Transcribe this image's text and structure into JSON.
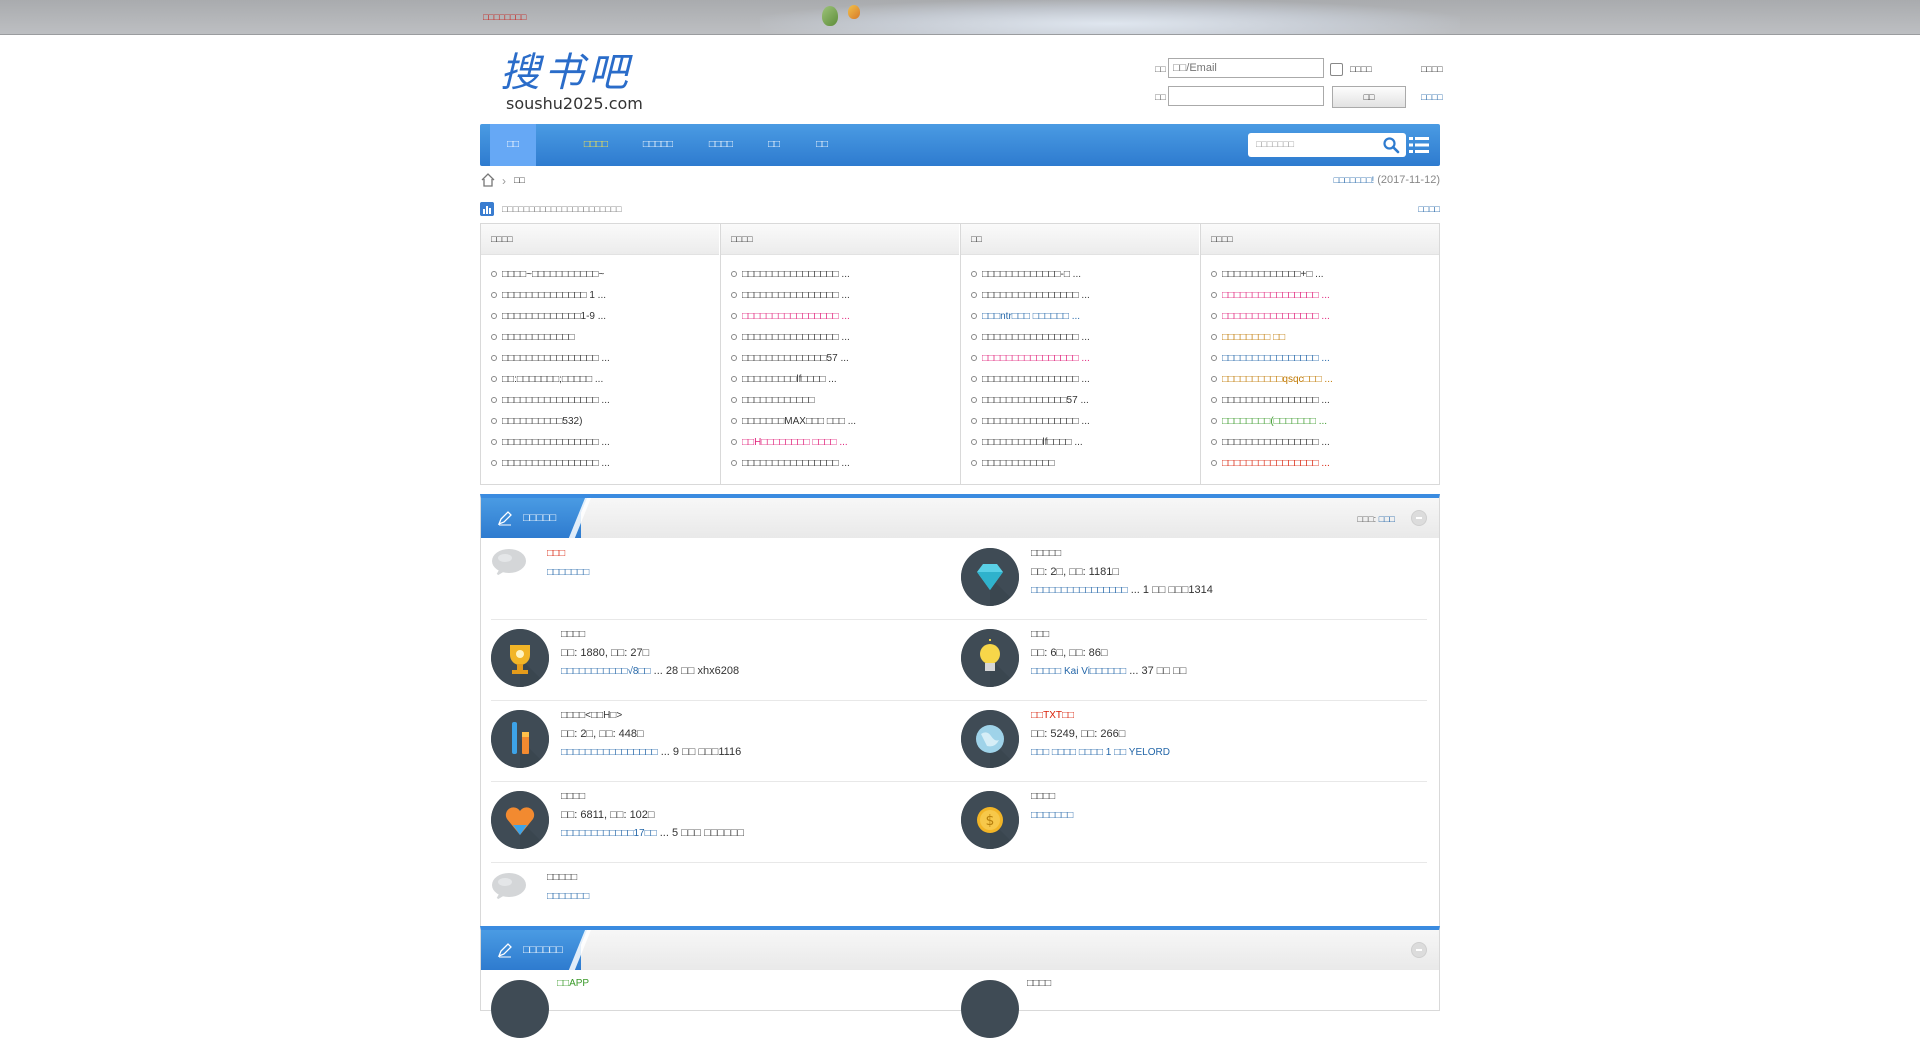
{
  "topbar": {
    "notice": "□□□□□□□□"
  },
  "logo": {
    "cn": "搜书吧",
    "en": "soushu2025.com"
  },
  "login": {
    "user_label": "□□",
    "user_placeholder": "□□/Email",
    "remember_label": "□□□□",
    "forgot_link": "□□□□",
    "pass_label": "□□",
    "submit": "□□",
    "register_link": "□□□□"
  },
  "nav": {
    "items": [
      "□□",
      "□□□□",
      "□□□□□",
      "□□□□",
      "□□",
      "□□"
    ],
    "search_placeholder": "□□□□□□□"
  },
  "breadcrumb": {
    "current": "□□",
    "right_link": "□□□□□□□!",
    "right_date": "(2017-11-12)"
  },
  "stats": {
    "text": "□□□□□□□□□□□□□□□□□□□□□□",
    "more": "□□□□"
  },
  "toplists": {
    "columns": [
      {
        "head": "□□□□",
        "items": [
          {
            "t": "□□□□~□□□□□□□□□□□~",
            "c": ""
          },
          {
            "t": "□□□□□□□□□□□□□□ 1 ...",
            "c": ""
          },
          {
            "t": "□□□□□□□□□□□□□1-9 ...",
            "c": ""
          },
          {
            "t": "□□□□□□□□□□□□",
            "c": ""
          },
          {
            "t": "□□□□□□□□□□□□□□□□ ...",
            "c": ""
          },
          {
            "t": "□□:□□□□□□□;□□□□□ ...",
            "c": ""
          },
          {
            "t": "□□□□□□□□□□□□□□□□ ...",
            "c": ""
          },
          {
            "t": "□□□□□□□□□□532)",
            "c": ""
          },
          {
            "t": "□□□□□□□□□□□□□□□□ ...",
            "c": ""
          },
          {
            "t": "□□□□□□□□□□□□□□□□ ...",
            "c": ""
          }
        ]
      },
      {
        "head": "□□□□",
        "items": [
          {
            "t": "□□□□□□□□□□□□□□□□ ...",
            "c": ""
          },
          {
            "t": "□□□□□□□□□□□□□□□□ ...",
            "c": ""
          },
          {
            "t": "□□□□□□□□□□□□□□□□ ...",
            "c": "c-pink"
          },
          {
            "t": "□□□□□□□□□□□□□□□□ ...",
            "c": ""
          },
          {
            "t": "□□□□□□□□□□□□□□57 ...",
            "c": ""
          },
          {
            "t": "□□□□□□□□□lf□□□□ ...",
            "c": ""
          },
          {
            "t": "□□□□□□□□□□□□",
            "c": ""
          },
          {
            "t": "□□□□□□□MAX□□□ □□□ ...",
            "c": ""
          },
          {
            "t": "□□H□□□□□□□□ □□□□ ...",
            "c": "c-pink"
          },
          {
            "t": "□□□□□□□□□□□□□□□□ ...",
            "c": ""
          }
        ]
      },
      {
        "head": "□□",
        "items": [
          {
            "t": "□□□□□□□□□□□□□-□ ...",
            "c": ""
          },
          {
            "t": "□□□□□□□□□□□□□□□□ ...",
            "c": ""
          },
          {
            "t": "□□□ntr□□□ □□□□□□ ...",
            "c": "c-blue"
          },
          {
            "t": "□□□□□□□□□□□□□□□□ ...",
            "c": ""
          },
          {
            "t": "□□□□□□□□□□□□□□□□ ...",
            "c": "c-pink"
          },
          {
            "t": "□□□□□□□□□□□□□□□□ ...",
            "c": ""
          },
          {
            "t": "□□□□□□□□□□□□□□57 ...",
            "c": ""
          },
          {
            "t": "□□□□□□□□□□□□□□□□ ...",
            "c": ""
          },
          {
            "t": "□□□□□□□□□□lf□□□□ ...",
            "c": ""
          },
          {
            "t": "□□□□□□□□□□□□",
            "c": ""
          }
        ]
      },
      {
        "head": "□□□□",
        "items": [
          {
            "t": "□□□□□□□□□□□□□+□ ...",
            "c": ""
          },
          {
            "t": "□□□□□□□□□□□□□□□□ ...",
            "c": "c-pink"
          },
          {
            "t": "□□□□□□□□□□□□□□□□ ...",
            "c": "c-pink"
          },
          {
            "t": "□□□□□□□□ □□",
            "c": "c-orange"
          },
          {
            "t": "□□□□□□□□□□□□□□□□ ...",
            "c": "c-blue"
          },
          {
            "t": "□□□□□□□□□□qsqc□□□ ...",
            "c": "c-orange"
          },
          {
            "t": "□□□□□□□□□□□□□□□□ ...",
            "c": ""
          },
          {
            "t": "□□□□□□□□(□□□□□□□ ...",
            "c": "c-green"
          },
          {
            "t": "□□□□□□□□□□□□□□□□ ...",
            "c": ""
          },
          {
            "t": "□□□□□□□□□□□□□□□□ ...",
            "c": "c-red"
          }
        ]
      }
    ]
  },
  "section1": {
    "title": "□□□□□",
    "moderator_label": "□□□: ",
    "moderator": "□□□",
    "forums": [
      {
        "name": "□□□",
        "name_color": "c-red",
        "meta": "",
        "last": "□□□□□□□",
        "icon": "bubble"
      },
      {
        "name": "□□□□□",
        "name_color": "",
        "meta": "□□: 2□, □□: 1181□",
        "last": "□□□□□□□□□□□□□□□□ ... 1 □□ □□□1314",
        "icon": "diamond"
      },
      {
        "name": "□□□□",
        "name_color": "",
        "meta": "□□: 1880, □□: 27□",
        "last": "□□□□□□□□□□□√8□□ ... 28 □□ xhx6208",
        "icon": "trophy"
      },
      {
        "name": "□□□",
        "name_color": "",
        "meta": "□□: 6□, □□: 86□",
        "last": "□□□□□ Kai Vi□□□□□□ ... 37 □□ □□",
        "icon": "bulb"
      },
      {
        "name": "□□□□<□□H□>",
        "name_color": "",
        "meta": "□□: 2□, □□: 448□",
        "last": "□□□□□□□□□□□□□□□□ ... 9 □□ □□□1116",
        "icon": "pencil"
      },
      {
        "name": "□□TXT□□",
        "name_color": "c-red",
        "meta": "□□: 5249, □□: 266□",
        "last": "□□□ □□□□ □□□□ 1 □□ YELORD",
        "icon": "globe"
      },
      {
        "name": "□□□□",
        "name_color": "",
        "meta": "□□: 6811, □□: 102□",
        "last": "□□□□□□□□□□□□17□□ ... 5 □□□ □□□□□□",
        "icon": "heart"
      },
      {
        "name": "□□□□",
        "name_color": "",
        "meta": "",
        "last": "□□□□□□□",
        "icon": "coin"
      },
      {
        "name": "□□□□□",
        "name_color": "",
        "meta": "",
        "last": "□□□□□□□",
        "icon": "bubble"
      }
    ]
  },
  "section2": {
    "title": "□□□□□□",
    "forums": [
      {
        "name": "□□APP",
        "name_color": "c-green"
      },
      {
        "name": "□□□□",
        "name_color": ""
      }
    ]
  },
  "colors": {
    "nav_blue": "#2e7bcf",
    "nav_active": "#66a8f5",
    "link_blue": "#2366a8",
    "alert_red": "#d81e06"
  }
}
